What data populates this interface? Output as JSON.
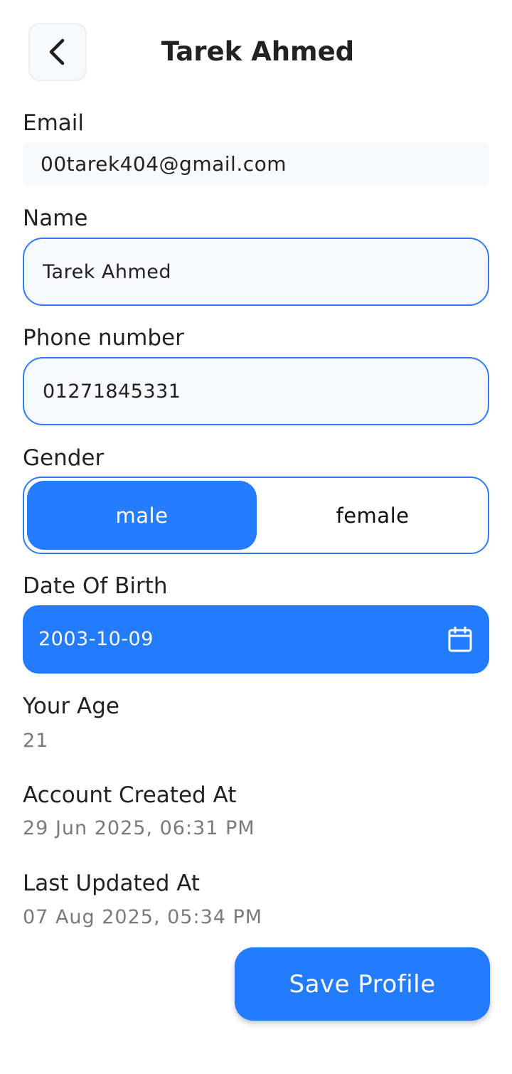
{
  "header": {
    "back_icon": "chevron-left-icon",
    "title": "Tarek Ahmed"
  },
  "email": {
    "label": "Email",
    "value": "00tarek404@gmail.com"
  },
  "name": {
    "label": "Name",
    "value": "Tarek Ahmed"
  },
  "phone": {
    "label": "Phone number",
    "value": "01271845331"
  },
  "gender": {
    "label": "Gender",
    "options": [
      "male",
      "female"
    ],
    "selected": "male"
  },
  "dob": {
    "label": "Date Of Birth",
    "value": "2003-10-09",
    "icon": "calendar-icon"
  },
  "age": {
    "label": "Your Age",
    "value": "21"
  },
  "created": {
    "label": "Account Created At",
    "value": "29 Jun 2025, 06:31 PM"
  },
  "updated": {
    "label": "Last Updated At",
    "value": "07 Aug 2025, 05:34 PM"
  },
  "actions": {
    "save_label": "Save Profile"
  },
  "colors": {
    "accent": "#237cfe",
    "field_border": "#2f7df6",
    "muted_text": "#7a7a7a"
  }
}
